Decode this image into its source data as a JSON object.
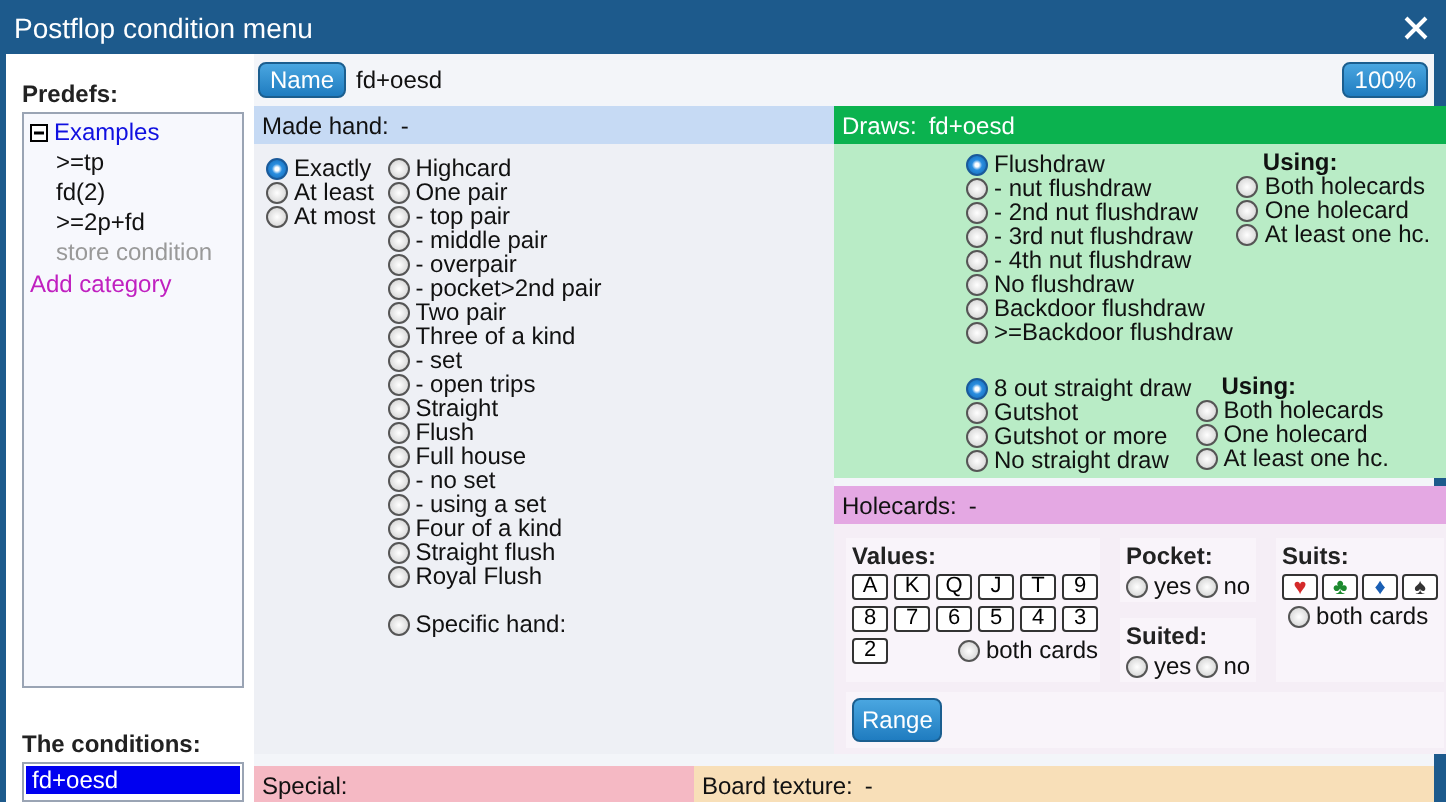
{
  "window": {
    "title": "Postflop condition menu"
  },
  "sidebar": {
    "predefs_label": "Predefs:",
    "tree": [
      {
        "label": "Examples",
        "expanded": true,
        "children": [
          {
            "label": ">=tp",
            "kind": "item"
          },
          {
            "label": "fd(2)",
            "kind": "item"
          },
          {
            "label": ">=2p+fd",
            "kind": "item"
          },
          {
            "label": "store condition",
            "kind": "action"
          }
        ]
      }
    ],
    "add_category": "Add category",
    "conditions_label": "The conditions:",
    "conditions": [
      {
        "label": "fd+oesd",
        "selected": true
      }
    ]
  },
  "name_bar": {
    "button": "Name",
    "value": "fd+oesd",
    "zoom": "100%"
  },
  "made_hand": {
    "title": "Made hand:",
    "value": "-",
    "modes": [
      {
        "label": "Exactly",
        "selected": true
      },
      {
        "label": "At least",
        "selected": false
      },
      {
        "label": "At most",
        "selected": false
      }
    ],
    "hands": [
      {
        "label": "Highcard",
        "selected": false
      },
      {
        "label": "One pair",
        "selected": false
      },
      {
        "label": "- top pair",
        "selected": false
      },
      {
        "label": "- middle pair",
        "selected": false
      },
      {
        "label": "- overpair",
        "selected": false
      },
      {
        "label": "- pocket>2nd pair",
        "selected": false
      },
      {
        "label": "Two pair",
        "selected": false
      },
      {
        "label": "Three of a kind",
        "selected": false
      },
      {
        "label": "- set",
        "selected": false
      },
      {
        "label": "- open trips",
        "selected": false
      },
      {
        "label": "Straight",
        "selected": false
      },
      {
        "label": "Flush",
        "selected": false
      },
      {
        "label": "Full house",
        "selected": false
      },
      {
        "label": "- no set",
        "selected": false
      },
      {
        "label": "- using a set",
        "selected": false
      },
      {
        "label": "Four of a kind",
        "selected": false
      },
      {
        "label": "Straight flush",
        "selected": false
      },
      {
        "label": "Royal Flush",
        "selected": false
      }
    ],
    "specific": {
      "label": "Specific hand:",
      "selected": false
    }
  },
  "draws": {
    "title": "Draws:",
    "value": "fd+oesd",
    "groups": [
      {
        "options": [
          {
            "label": "Flushdraw",
            "selected": true
          },
          {
            "label": "- nut flushdraw",
            "selected": false
          },
          {
            "label": "- 2nd nut flushdraw",
            "selected": false
          },
          {
            "label": "- 3rd nut flushdraw",
            "selected": false
          },
          {
            "label": "- 4th nut flushdraw",
            "selected": false
          },
          {
            "label": "No flushdraw",
            "selected": false
          },
          {
            "label": "Backdoor flushdraw",
            "selected": false
          },
          {
            "label": ">=Backdoor flushdraw",
            "selected": false
          }
        ],
        "using_label": "Using:",
        "using": [
          {
            "label": "Both holecards",
            "selected": false
          },
          {
            "label": "One holecard",
            "selected": false
          },
          {
            "label": "At least one hc.",
            "selected": false
          }
        ]
      },
      {
        "options": [
          {
            "label": "8 out straight draw",
            "selected": true
          },
          {
            "label": "Gutshot",
            "selected": false
          },
          {
            "label": "Gutshot or more",
            "selected": false
          },
          {
            "label": "No straight draw",
            "selected": false
          }
        ],
        "using_label": "Using:",
        "using": [
          {
            "label": "Both holecards",
            "selected": false
          },
          {
            "label": "One holecard",
            "selected": false
          },
          {
            "label": "At least one hc.",
            "selected": false
          }
        ]
      }
    ]
  },
  "holecards": {
    "title": "Holecards:",
    "value": "-",
    "values_label": "Values:",
    "ranks": [
      "A",
      "K",
      "Q",
      "J",
      "T",
      "9",
      "8",
      "7",
      "6",
      "5",
      "4",
      "3",
      "2"
    ],
    "values_both": {
      "label": "both cards",
      "selected": false
    },
    "pocket": {
      "label": "Pocket:",
      "options": [
        {
          "label": "yes",
          "selected": false
        },
        {
          "label": "no",
          "selected": false
        }
      ]
    },
    "suited": {
      "label": "Suited:",
      "options": [
        {
          "label": "yes",
          "selected": false
        },
        {
          "label": "no",
          "selected": false
        }
      ]
    },
    "suits_label": "Suits:",
    "suits": [
      {
        "symbol": "♥",
        "color": "#d42a2a"
      },
      {
        "symbol": "♣",
        "color": "#1c8a2e"
      },
      {
        "symbol": "♦",
        "color": "#1a5fb4"
      },
      {
        "symbol": "♠",
        "color": "#333333"
      }
    ],
    "suits_both": {
      "label": "both cards",
      "selected": false
    },
    "range_button": "Range"
  },
  "special": {
    "title": "Special:"
  },
  "board_texture": {
    "title": "Board texture:",
    "value": "-"
  }
}
